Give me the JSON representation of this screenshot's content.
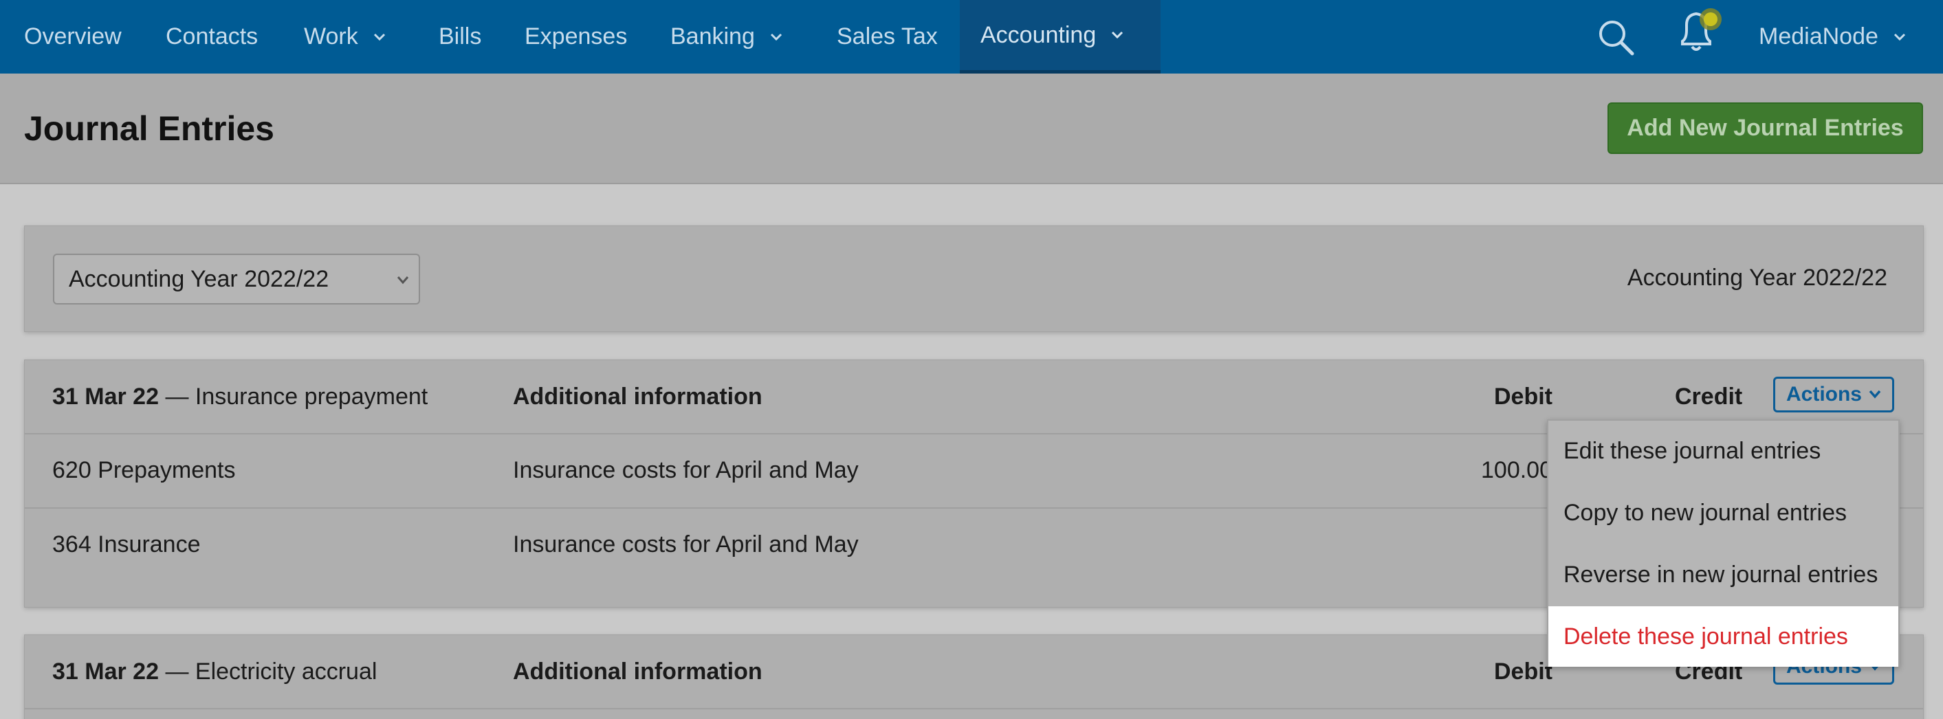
{
  "nav": {
    "items": [
      {
        "label": "Overview"
      },
      {
        "label": "Contacts"
      },
      {
        "label": "Work"
      },
      {
        "label": "Bills"
      },
      {
        "label": "Expenses"
      },
      {
        "label": "Banking"
      },
      {
        "label": "Sales Tax"
      },
      {
        "label": "Accounting"
      }
    ],
    "account_label": "MediaNode",
    "active": "Accounting"
  },
  "page": {
    "title": "Journal Entries",
    "add_button_label": "Add New Journal Entries"
  },
  "filter": {
    "selected_year": "Accounting Year 2022/22",
    "current_year_label": "Accounting Year 2022/22"
  },
  "entries": [
    {
      "date": "31 Mar 22",
      "separator": "—",
      "description": "Insurance prepayment",
      "col_info": "Additional information",
      "col_debit": "Debit",
      "col_credit": "Credit",
      "actions_label": "Actions",
      "lines": [
        {
          "account": "620 Prepayments",
          "info": "Insurance costs for April and May",
          "debit": "100.00"
        },
        {
          "account": "364 Insurance",
          "info": "Insurance costs for April and May",
          "debit": ""
        }
      ]
    },
    {
      "date": "31 Mar 22",
      "separator": "—",
      "description": "Electricity accrual",
      "col_info": "Additional information",
      "col_debit": "Debit",
      "col_credit": "Credit",
      "actions_label": "Actions"
    }
  ],
  "actions_menu": {
    "items": [
      {
        "label": "Edit these journal entries"
      },
      {
        "label": "Copy to new journal entries"
      },
      {
        "label": "Reverse in new journal entries"
      },
      {
        "label": "Delete these journal entries"
      }
    ]
  },
  "colors": {
    "nav_bg": "#005b94",
    "primary_button": "#3e7a2e",
    "danger_text": "#d9262a",
    "link_blue": "#0b5c96"
  }
}
